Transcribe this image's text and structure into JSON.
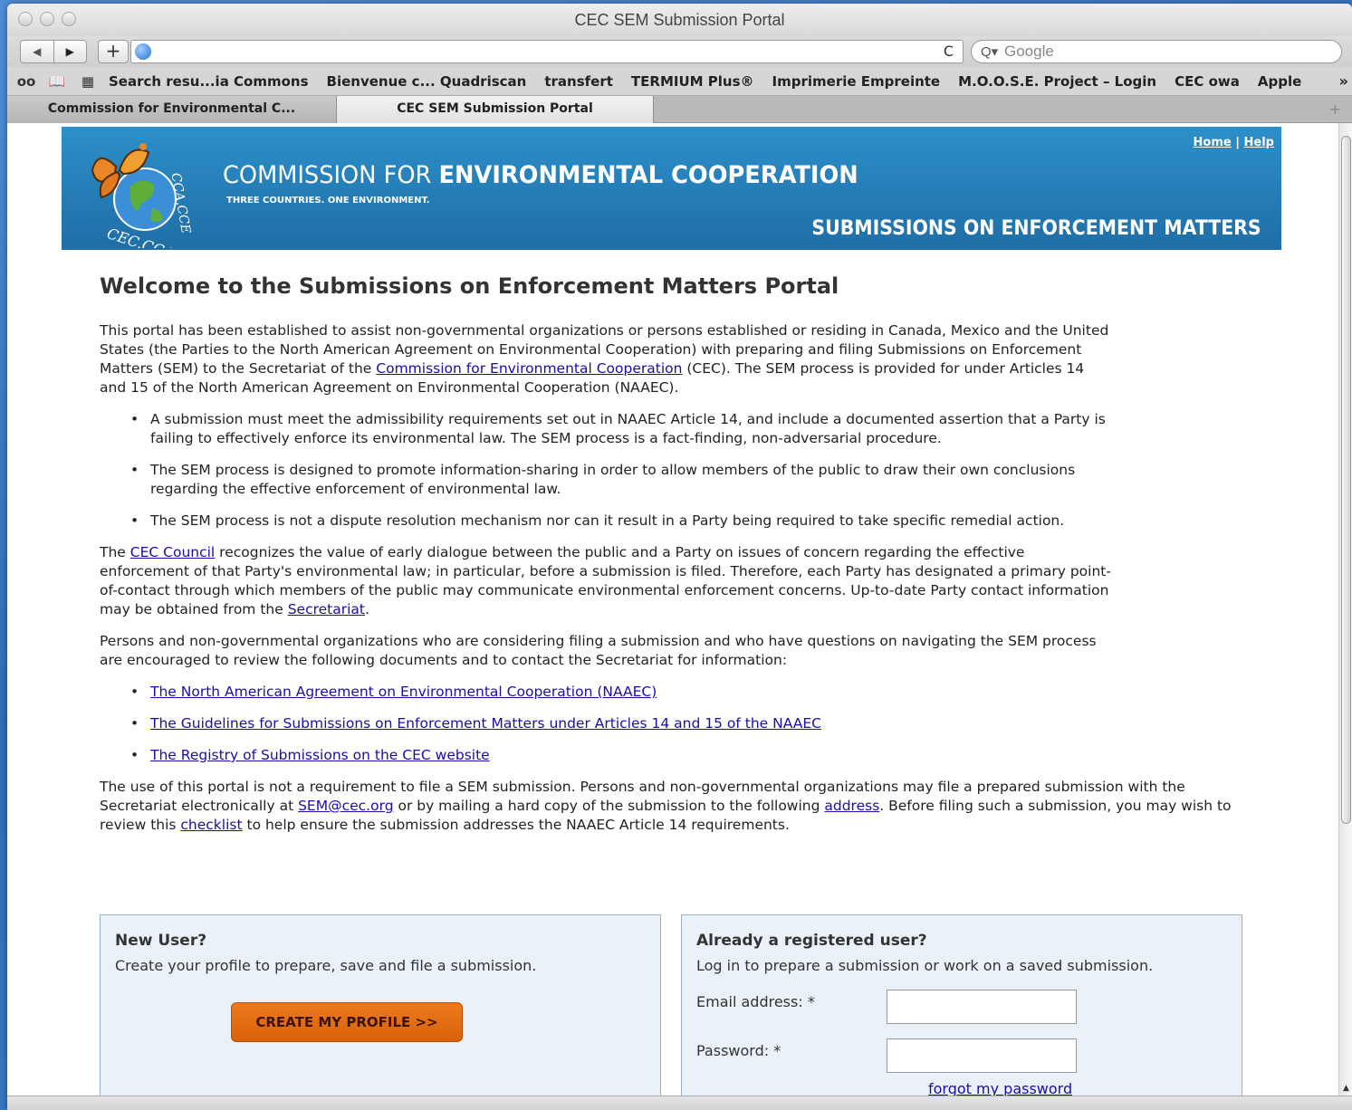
{
  "window": {
    "title": "CEC SEM Submission Portal"
  },
  "toolbar": {
    "back_icon": "◀",
    "forward_icon": "▶",
    "add_icon": "+",
    "url": "",
    "reload_icon": "C",
    "search_placeholder": "Google",
    "search_icon": "Q▾"
  },
  "bookmarks": {
    "reader_icon": "oo",
    "book_icon": "📖",
    "grid_icon": "▦",
    "items": [
      "Search resu...ia Commons",
      "Bienvenue c... Quadriscan",
      "transfert",
      "TERMIUM Plus®",
      "Imprimerie Empreinte",
      "M.O.O.S.E. Project – Login",
      "CEC owa",
      "Apple"
    ],
    "overflow": "»"
  },
  "tabs": [
    {
      "label": "Commission for Environmental C...",
      "active": false
    },
    {
      "label": "CEC SEM Submission Portal",
      "active": true
    }
  ],
  "banner": {
    "org_regular": "COMMISSION FOR ",
    "org_bold": "ENVIRONMENTAL COOPERATION",
    "tagline": "THREE COUNTRIES. ONE ENVIRONMENT.",
    "home_link": "Home",
    "separator": "|",
    "help_link": "Help",
    "section": "SUBMISSIONS ON ENFORCEMENT MATTERS",
    "logo_text_top": "CCA.CCE",
    "logo_text_bottom": "CEC.CCA"
  },
  "content": {
    "heading": "Welcome to the Submissions on Enforcement Matters Portal",
    "intro_1": "This portal has been established to assist non-governmental organizations or persons established or residing in Canada, Mexico and the United States (the Parties to the North American Agreement on Environmental Cooperation) with preparing and filing Submissions on Enforcement Matters (SEM) to the Secretariat of the ",
    "intro_link": "Commission for Environmental Cooperation",
    "intro_2": " (CEC). The SEM process is provided for under Articles 14 and 15 of the North American Agreement on Environmental Cooperation (NAAEC).",
    "bullets": [
      "A submission must meet the admissibility requirements set out in NAAEC Article 14, and include a documented assertion that a Party is failing to effectively enforce its environmental law. The SEM process is a fact-finding, non-adversarial procedure.",
      "The SEM process is designed to promote information-sharing in order to allow members of the public to draw their own conclusions regarding the effective enforcement of environmental law.",
      "The SEM process is not a dispute resolution mechanism nor can it result in a Party being required to take specific remedial action."
    ],
    "council_1": "The ",
    "council_link": "CEC Council",
    "council_2": " recognizes the value of early dialogue between the public and a Party on issues of concern regarding the effective enforcement of that Party's environmental law; in particular, before a submission is filed. Therefore, each Party has designated a primary point-of-contact through which members of the public may communicate environmental enforcement concerns. Up-to-date Party contact information may be obtained from the ",
    "secretariat_link": "Secretariat",
    "council_3": ".",
    "persons": "Persons and non-governmental organizations who are considering filing a submission and who have questions on navigating the SEM process are encouraged to review the following documents and to contact the Secretariat for information:",
    "doc_links": [
      "The North American Agreement on Environmental Cooperation (NAAEC)",
      "The Guidelines for Submissions on Enforcement Matters under Articles 14 and 15 of the NAAEC",
      "The Registry of Submissions on the CEC website"
    ],
    "final_1": "The use of this portal is not a requirement to file a SEM submission. Persons and non-governmental organizations may file a prepared submission with the Secretariat electronically at ",
    "email_link": "SEM@cec.org",
    "final_2": " or by mailing a hard copy of the submission to the following ",
    "address_link": "address",
    "final_3": ". Before filing such a submission, you may wish to review this ",
    "checklist_link": "checklist",
    "final_4": " to help ensure the submission addresses the NAAEC Article 14 requirements."
  },
  "new_user": {
    "title": "New User?",
    "text": "Create your profile to prepare, save and file a submission.",
    "button": "CREATE MY PROFILE >>"
  },
  "login": {
    "title": "Already a registered user?",
    "text": "Log in to prepare a submission or work on a saved submission.",
    "email_label": "Email address: *",
    "password_label": "Password: *",
    "forgot": "forgot my password"
  },
  "colors": {
    "banner": "#2080bb",
    "button": "#e86e12",
    "link": "#1a0dab",
    "box_bg": "#eaf1f8"
  }
}
